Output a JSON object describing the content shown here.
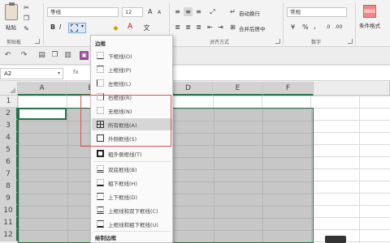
{
  "ribbon": {
    "paste_label": "粘贴",
    "clipboard_label": "剪贴板",
    "font_name": "等线",
    "font_size": "12",
    "wrap_text": "自动换行",
    "merge_center": "合并后居中",
    "number_format": "常规",
    "alignment_label": "对齐方式",
    "number_label": "数字",
    "conditional_format": "条件格式",
    "percent": "%",
    "comma": ",",
    "bold": "B",
    "italic": "I",
    "underline": "U",
    "font_color_letter": "A",
    "grow_font": "A",
    "shrink_font": "A"
  },
  "namebox": {
    "value": "A2"
  },
  "formula": {
    "fx": "fx",
    "value": ""
  },
  "columns": [
    "A",
    "B",
    "C",
    "D",
    "E",
    "F"
  ],
  "rows": [
    "1",
    "2",
    "3",
    "4",
    "5",
    "6",
    "7",
    "8",
    "9",
    "10",
    "11",
    "12"
  ],
  "menu": {
    "header": "边框",
    "items": [
      {
        "label": "下框线(O)"
      },
      {
        "label": "上框线(P)"
      },
      {
        "label": "左框线(L)"
      },
      {
        "label": "右框线(R)"
      },
      {
        "label": "无框线(N)"
      },
      {
        "label": "所有框线(A)"
      },
      {
        "label": "外侧框线(S)"
      },
      {
        "label": "粗外侧框线(T)"
      },
      {
        "label": "双底框线(B)"
      },
      {
        "label": "粗下框线(H)"
      },
      {
        "label": "上下框线(D)"
      },
      {
        "label": "上框线和双下框线(C)"
      },
      {
        "label": "上框线和粗下框线(U)"
      }
    ],
    "draw_header": "绘制边框"
  },
  "colors": {
    "accent": "#217346",
    "highlight_box": "#d9534f"
  }
}
